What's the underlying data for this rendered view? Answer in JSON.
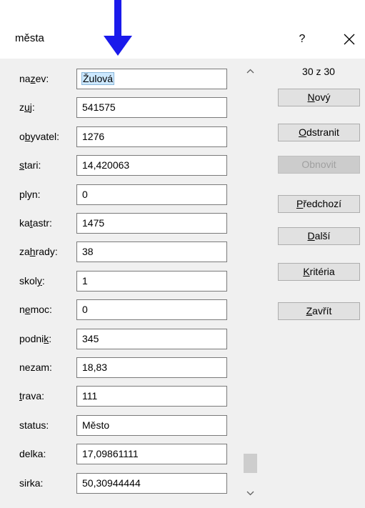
{
  "window": {
    "title": "města",
    "help_label": "?",
    "close_icon": "close-icon",
    "arrow_color": "#1a1aeb"
  },
  "record": {
    "counter": "30 z 30"
  },
  "fields": [
    {
      "pre": "na",
      "key": "z",
      "post": "ev:",
      "value": "Žulová",
      "selected": true
    },
    {
      "pre": "z",
      "key": "u",
      "post": "j:",
      "value": "541575"
    },
    {
      "pre": "o",
      "key": "b",
      "post": "yvatel:",
      "value": "1276"
    },
    {
      "pre": "",
      "key": "s",
      "post": "tari:",
      "value": "14,420063"
    },
    {
      "pre": "plyn:",
      "key": "",
      "post": "",
      "value": "0"
    },
    {
      "pre": "ka",
      "key": "t",
      "post": "astr:",
      "value": "1475"
    },
    {
      "pre": "za",
      "key": "h",
      "post": "rady:",
      "value": "38"
    },
    {
      "pre": "skol",
      "key": "y",
      "post": ":",
      "value": "1"
    },
    {
      "pre": "n",
      "key": "e",
      "post": "moc:",
      "value": "0"
    },
    {
      "pre": "podni",
      "key": "k",
      "post": ":",
      "value": "345"
    },
    {
      "pre": "nezam:",
      "key": "",
      "post": "",
      "value": "18,83"
    },
    {
      "pre": "",
      "key": "t",
      "post": "rava:",
      "value": "111"
    },
    {
      "pre": "status:",
      "key": "",
      "post": "",
      "value": "Město"
    },
    {
      "pre": "delka:",
      "key": "",
      "post": "",
      "value": "17,09861111"
    },
    {
      "pre": "sirka:",
      "key": "",
      "post": "",
      "value": "50,30944444"
    }
  ],
  "buttons": {
    "new": {
      "pre": "",
      "key": "N",
      "post": "ový"
    },
    "delete": {
      "pre": "",
      "key": "O",
      "post": "dstranit"
    },
    "restore": {
      "pre": "",
      "key": "",
      "post": "Obnovit",
      "disabled": true
    },
    "prev": {
      "pre": "",
      "key": "P",
      "post": "ředchozí"
    },
    "next": {
      "pre": "",
      "key": "D",
      "post": "alší"
    },
    "criteria": {
      "pre": "",
      "key": "K",
      "post": "ritéria"
    },
    "close": {
      "pre": "",
      "key": "Z",
      "post": "avřít"
    }
  },
  "scrollbar": {
    "up_icon": "chevron-up-icon",
    "down_icon": "chevron-down-icon"
  }
}
